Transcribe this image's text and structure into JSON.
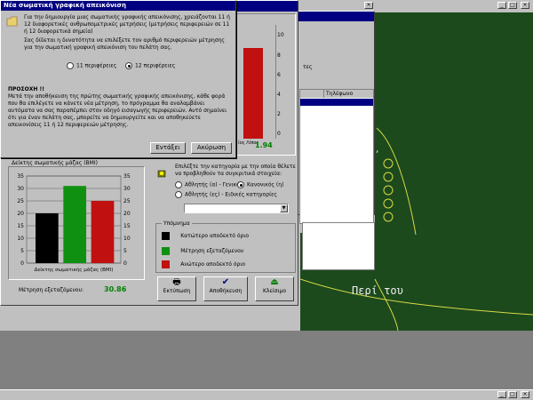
{
  "dialog": {
    "title": "Νέα σωματική γραφική απεικόνιση",
    "text1": "Για την δημιουργία μιας σωματικής γραφικής απεικόνισης, χρειάζονται 11 ή 12 διαφορετικές ανθρωπομετρικές μετρήσεις (μετρήσεις περιφερειών σε 11 ή 12 διαφορετικά σημεία)",
    "text2": "Σας δίδεται η δυνατότητα να επιλέξετε τον αριθμό περιφερειών μέτρησης για την σωματική γραφική απεικόνιση του πελάτη σας.",
    "option_11": "11 περιφέρειες",
    "option_12": "12 περιφέρειες",
    "selected": "12 περιφέρειες",
    "warning_title": "ΠΡΟΣΟΧΗ !!",
    "warning_text": "Μετά την αποθήκευση της πρώτης σωματικής γραφικής απεικόνισης, κάθε φορά που θα επιλέγετε να κάνετε νέα μέτρηση, το πρόγραμμα θα αναλαμβάνει αυτόματα να σας παραπέμπει στον οδηγό εισαγωγής περιφερειών. Αυτό σημαίνει ότι για έναν πελάτη σας, μπορείτε να δημιουργείτε και να αποθηκεύετε απεικονίσεις 11 ή 12 περιφερειών μέτρησης.",
    "ok_label": "Εντάξει",
    "cancel_label": "Ακύρωση"
  },
  "top_chart": {
    "tick_labels": [
      "10",
      "8",
      "6",
      "4",
      "2",
      "0"
    ],
    "x_label": "ίος Λίπος",
    "value_text": "1.94"
  },
  "bmi_panel": {
    "title": "Δείκτης σωματικής μάζας (BMI)",
    "measure_label": "Μέτρηση εξεταζόμενου:",
    "measure_value": "30.86"
  },
  "chart_data": {
    "type": "bar",
    "categories": [
      "Κατώτερο αποδεκτό όριο",
      "Μέτρηση εξεταζόμενου",
      "Ανώτερο αποδεκτό όριο"
    ],
    "values": [
      20,
      31,
      25
    ],
    "colors": [
      "#000000",
      "#109010",
      "#c01010"
    ],
    "ylim": [
      0,
      35
    ],
    "yticks": [
      "35",
      "30",
      "25",
      "20",
      "15",
      "10",
      "5",
      "0"
    ],
    "xlabel": "Δείκτης σωματικής μάζας (BMI)",
    "grid": true
  },
  "category": {
    "prompt": "Επιλέξτε την κατηγορία με την οποία θέλετε να προβληθούν τα συγκριτικά στοιχεία:",
    "option_athlete": "Αθλητής (α) - Γενικά",
    "option_normal": "Κανονικός (η)",
    "option_special": "Αθλητής (ες) - Ειδικές κατηγορίες",
    "selected": "Κανονικός (η)",
    "dropdown_value": ""
  },
  "legend": {
    "title": "Υπόμνημα",
    "items": [
      {
        "label": "Κατώτερο αποδεκτό όριο",
        "color": "#000000"
      },
      {
        "label": "Μέτρηση εξεταζόμενου",
        "color": "#109010"
      },
      {
        "label": "Ανώτερο αποδεκτό όριο",
        "color": "#c01010"
      }
    ]
  },
  "buttons": {
    "print": "Εκτύπωση",
    "save": "Αποθήκευση",
    "close": "Κλείσιμο"
  },
  "background": {
    "tab_label": "τες",
    "table_header": "Τηλέφωνο",
    "chalk_text": "Περί του",
    "title_buttons": [
      "_",
      "□",
      "×"
    ]
  },
  "taskbar": {
    "buttons": [
      "_",
      "□",
      "×"
    ]
  },
  "colors": {
    "title_bar": "#000080",
    "board": "#1c4a1c",
    "dialog_bg": "#c0c0c0"
  }
}
